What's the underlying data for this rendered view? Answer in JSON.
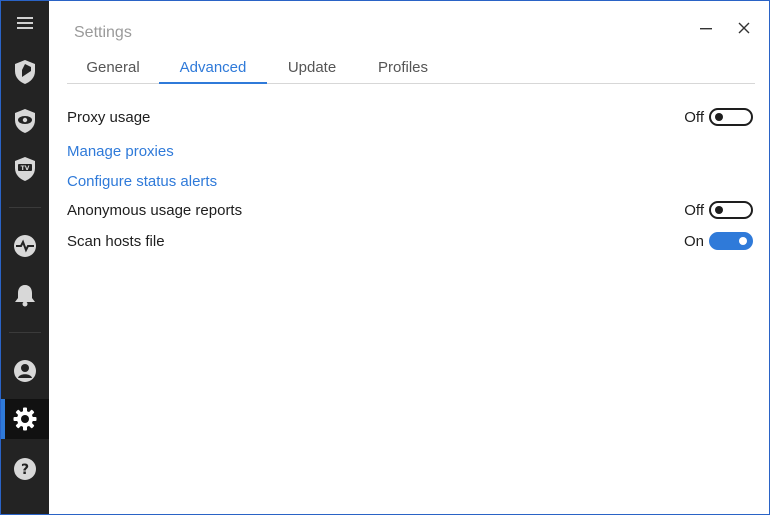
{
  "window": {
    "title": "Settings"
  },
  "sidebar": {
    "items": [
      {
        "name": "menu-icon"
      },
      {
        "name": "shield-icon"
      },
      {
        "name": "eye-shield-icon"
      },
      {
        "name": "tv-shield-icon"
      },
      {
        "name": "activity-icon"
      },
      {
        "name": "bell-icon"
      },
      {
        "name": "user-icon"
      },
      {
        "name": "gear-icon",
        "active": true
      },
      {
        "name": "help-icon"
      }
    ]
  },
  "tabs": [
    {
      "label": "General"
    },
    {
      "label": "Advanced",
      "active": true
    },
    {
      "label": "Update"
    },
    {
      "label": "Profiles"
    }
  ],
  "settings": {
    "proxy_usage": {
      "label": "Proxy usage",
      "state": "Off"
    },
    "manage_proxies": "Manage proxies",
    "configure_alerts": "Configure status alerts",
    "anonymous_reports": {
      "label": "Anonymous usage reports",
      "state": "Off"
    },
    "scan_hosts": {
      "label": "Scan hosts file",
      "state": "On"
    }
  },
  "colors": {
    "accent": "#2f7ad9",
    "sidebar_bg": "#232323",
    "text": "#1e1e1e",
    "title_gray": "#9a9a9a"
  }
}
